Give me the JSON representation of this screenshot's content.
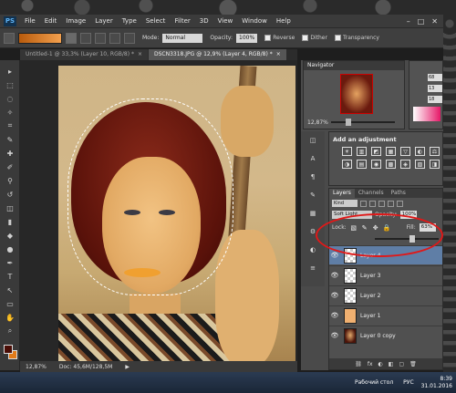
{
  "app": {
    "logo": "PS"
  },
  "menu": [
    "File",
    "Edit",
    "Image",
    "Layer",
    "Type",
    "Select",
    "Filter",
    "3D",
    "View",
    "Window",
    "Help"
  ],
  "window_controls": [
    "–",
    "□",
    "✕"
  ],
  "options": {
    "mode_label": "Mode:",
    "mode_value": "Normal",
    "opacity_label": "Opacity:",
    "opacity_value": "100%",
    "reverse": "Reverse",
    "dither": "Dither",
    "transparency": "Transparency",
    "gradient_colors": [
      "#b95b0c",
      "#f3a04e"
    ]
  },
  "tabs": [
    {
      "label": "Untitled-1 @ 33,3% (Layer 10, RGB/8) *",
      "active": false
    },
    {
      "label": "DSCN3318.JPG @ 12,9% (Layer 4, RGB/8) *",
      "active": true
    }
  ],
  "tab_close": "×",
  "tools": [
    "move-icon",
    "marquee-icon",
    "lasso-icon",
    "quick-select-icon",
    "crop-icon",
    "eyedropper-icon",
    "healing-icon",
    "brush-icon",
    "clone-stamp-icon",
    "history-brush-icon",
    "eraser-icon",
    "gradient-icon",
    "blur-icon",
    "dodge-icon",
    "pen-icon",
    "type-icon",
    "path-select-icon",
    "shape-icon",
    "hand-icon",
    "zoom-icon"
  ],
  "tool_glyphs": [
    "▸",
    "⬚",
    "◌",
    "✧",
    "⌗",
    "✎",
    "✚",
    "✐",
    "⚲",
    "↺",
    "◫",
    "▮",
    "◆",
    "●",
    "✒",
    "T",
    "↖",
    "▭",
    "✋",
    "⌕"
  ],
  "colors": {
    "foreground": "#4a0d06",
    "background": "#e37b1a",
    "accent_annotation": "#e01818",
    "selected_layer": "#5f7ea6"
  },
  "status": {
    "zoom": "12,87%",
    "doc": "Doc: 45,6M/128,5M",
    "arrow": "▶"
  },
  "navigator": {
    "title": "Navigator",
    "zoom": "12,87%"
  },
  "info_values": [
    "68",
    "13",
    "18"
  ],
  "adjustments": {
    "title": "Add an adjustment",
    "icons": [
      "☀",
      "▥",
      "◩",
      "▦",
      "▽",
      "◐",
      "⚖",
      "◑",
      "▤",
      "◉",
      "▩",
      "◈",
      "▧",
      "◨"
    ]
  },
  "side_icons": [
    "◫",
    "A",
    "¶",
    "✎",
    "▦",
    "⚙",
    "◐",
    "≡"
  ],
  "layers": {
    "tabs": [
      "Layers",
      "Channels",
      "Paths"
    ],
    "kind": "Kind",
    "blend_mode": "Soft Light",
    "opacity_label": "Opacity:",
    "opacity_value": "100%",
    "lock_label": "Lock:",
    "fill_label": "Fill:",
    "fill_value": "63%",
    "lock_icons": [
      "▧",
      "✎",
      "✥",
      "🔒"
    ],
    "rows": [
      {
        "name": "Layer 4",
        "thumb": "checker",
        "selected": true
      },
      {
        "name": "Layer 3",
        "thumb": "checker",
        "selected": false
      },
      {
        "name": "Layer 2",
        "thumb": "checker",
        "selected": false
      },
      {
        "name": "Layer 1",
        "thumb": "orange",
        "selected": false
      },
      {
        "name": "Layer 0 copy",
        "thumb": "photo",
        "selected": false
      }
    ],
    "eye_glyph": "👁",
    "footer_icons": [
      "⛓",
      "fx",
      "◐",
      "◧",
      "▢",
      "🗑"
    ]
  },
  "taskbar": {
    "desktop": "Рабочий стол",
    "lang": "РУС",
    "time": "8:39",
    "date": "31.01.2016"
  }
}
